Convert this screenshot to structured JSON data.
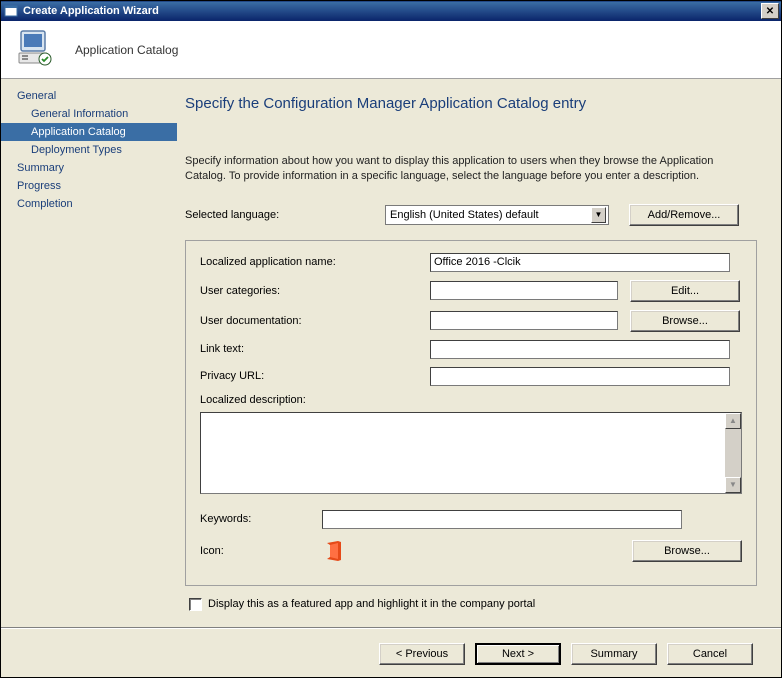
{
  "window": {
    "title": "Create Application Wizard"
  },
  "banner": {
    "title": "Application Catalog"
  },
  "sidebar": {
    "items": [
      {
        "label": "General"
      },
      {
        "label": "General Information"
      },
      {
        "label": "Application Catalog"
      },
      {
        "label": "Deployment Types"
      },
      {
        "label": "Summary"
      },
      {
        "label": "Progress"
      },
      {
        "label": "Completion"
      }
    ]
  },
  "main": {
    "title": "Specify the Configuration Manager Application Catalog entry",
    "instruction": "Specify information about how you want to display this application to users when they browse the Application Catalog. To provide information in a specific language, select the language before you enter a description.",
    "language": {
      "label": "Selected language:",
      "value": "English (United States) default",
      "button": "Add/Remove..."
    },
    "fields": {
      "app_name_label": "Localized application name:",
      "app_name_value": "Office 2016 -Clcik",
      "categories_label": "User categories:",
      "categories_value": "",
      "categories_button": "Edit...",
      "documentation_label": "User documentation:",
      "documentation_value": "",
      "documentation_button": "Browse...",
      "link_text_label": "Link text:",
      "link_text_value": "",
      "privacy_label": "Privacy URL:",
      "privacy_value": "",
      "description_label": "Localized description:",
      "description_value": "",
      "keywords_label": "Keywords:",
      "keywords_value": "",
      "icon_label": "Icon:",
      "icon_button": "Browse..."
    },
    "checkbox_label": "Display this as a featured app and highlight it in the company portal"
  },
  "buttons": {
    "previous": "< Previous",
    "next": "Next >",
    "summary": "Summary",
    "cancel": "Cancel"
  }
}
